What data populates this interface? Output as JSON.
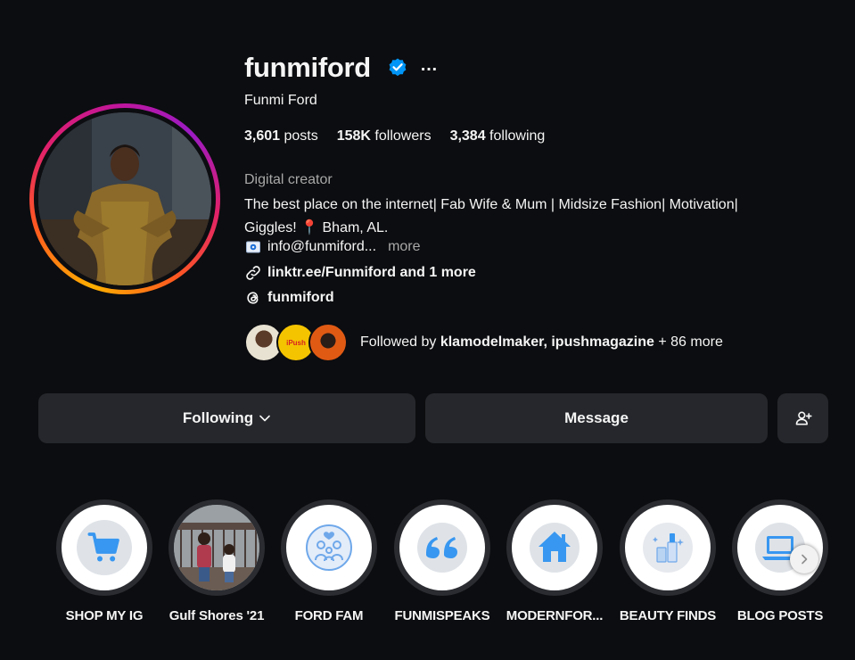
{
  "profile": {
    "username": "funmiford",
    "full_name": "Funmi Ford",
    "more_icon": "…",
    "stats": {
      "posts_count": "3,601",
      "posts_label": " posts",
      "followers_count": "158K",
      "followers_label": " followers",
      "following_count": "3,384",
      "following_label": " following"
    },
    "category": "Digital creator",
    "bio_line1": "The best place on the internet| Fab Wife & Mum | Midsize Fashion| Motivation|",
    "bio_line2": "Giggles! 📍 Bham, AL.",
    "email_text": "info@funmiford...",
    "email_more": "more",
    "link_text": "linktr.ee/Funmiford and 1 more",
    "threads_handle": "funmiford",
    "followed_by_prefix": "Followed by ",
    "followed_by_names": "klamodelmaker, ipushmagazine",
    "followed_by_suffix": " + 86 more",
    "mini_avatar_2_text": "iPush"
  },
  "actions": {
    "following_label": "Following",
    "message_label": "Message"
  },
  "highlights": [
    {
      "label": "SHOP MY IG",
      "icon": "cart-icon"
    },
    {
      "label": "Gulf Shores '21",
      "icon": "photo-children"
    },
    {
      "label": "FORD FAM",
      "icon": "family-icon"
    },
    {
      "label": "FUNMISPEAKS",
      "icon": "quote-icon"
    },
    {
      "label": "MODERNFOR...",
      "icon": "home-icon"
    },
    {
      "label": "BEAUTY FINDS",
      "icon": "beauty-icon"
    },
    {
      "label": "BLOG POSTS",
      "icon": "laptop-icon"
    }
  ],
  "colors": {
    "background": "#0c0d10",
    "button_bg": "#25272c",
    "verified_blue": "#0095f6",
    "highlight_icon_blue": "#3897f0",
    "muted_text": "#a8a8a8"
  }
}
